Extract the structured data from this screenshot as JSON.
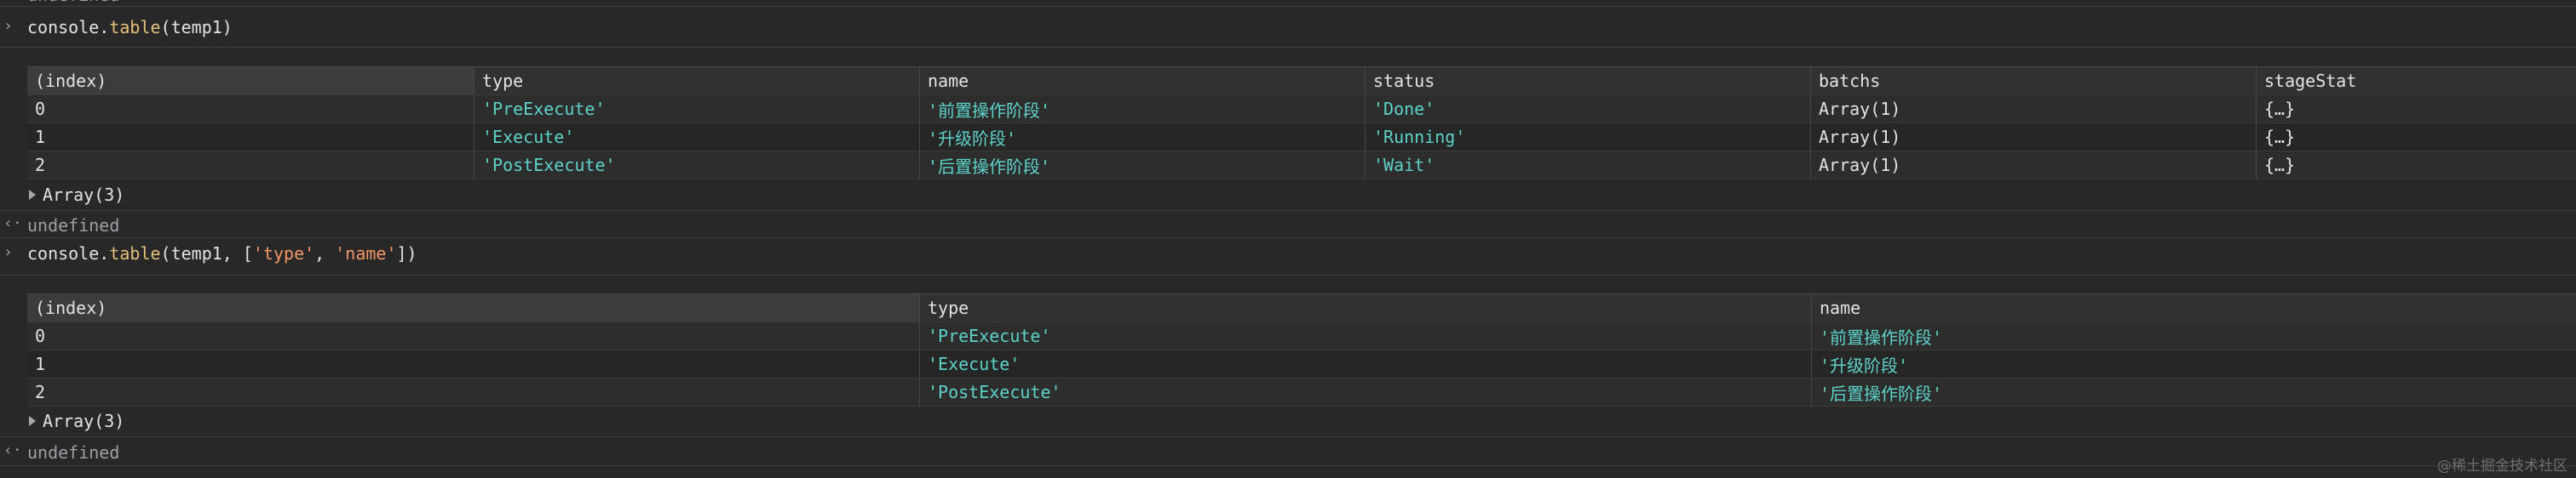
{
  "console": {
    "top_partial_result": "undefined",
    "command1": {
      "prefix": "console.",
      "fn": "table",
      "args": "(temp1)"
    },
    "table1": {
      "headers": [
        "(index)",
        "type",
        "name",
        "status",
        "batchs",
        "stageStat"
      ],
      "rows": [
        [
          "0",
          "'PreExecute'",
          "'前置操作阶段'",
          "'Done'",
          "Array(1)",
          "{…}"
        ],
        [
          "1",
          "'Execute'",
          "'升级阶段'",
          "'Running'",
          "Array(1)",
          "{…}"
        ],
        [
          "2",
          "'PostExecute'",
          "'后置操作阶段'",
          "'Wait'",
          "Array(1)",
          "{…}"
        ]
      ]
    },
    "array_label1": "Array(3)",
    "result1": "undefined",
    "command2": {
      "prefix": "console.",
      "fn": "table",
      "open": "(temp1, [",
      "arg1": "'type'",
      "comma": ", ",
      "arg2": "'name'",
      "close": "])"
    },
    "table2": {
      "headers": [
        "(index)",
        "type",
        "name"
      ],
      "rows": [
        [
          "0",
          "'PreExecute'",
          "'前置操作阶段'"
        ],
        [
          "1",
          "'Execute'",
          "'升级阶段'"
        ],
        [
          "2",
          "'PostExecute'",
          "'后置操作阶段'"
        ]
      ]
    },
    "array_label2": "Array(3)",
    "result2": "undefined"
  },
  "watermark": "@稀土掘金技术社区"
}
